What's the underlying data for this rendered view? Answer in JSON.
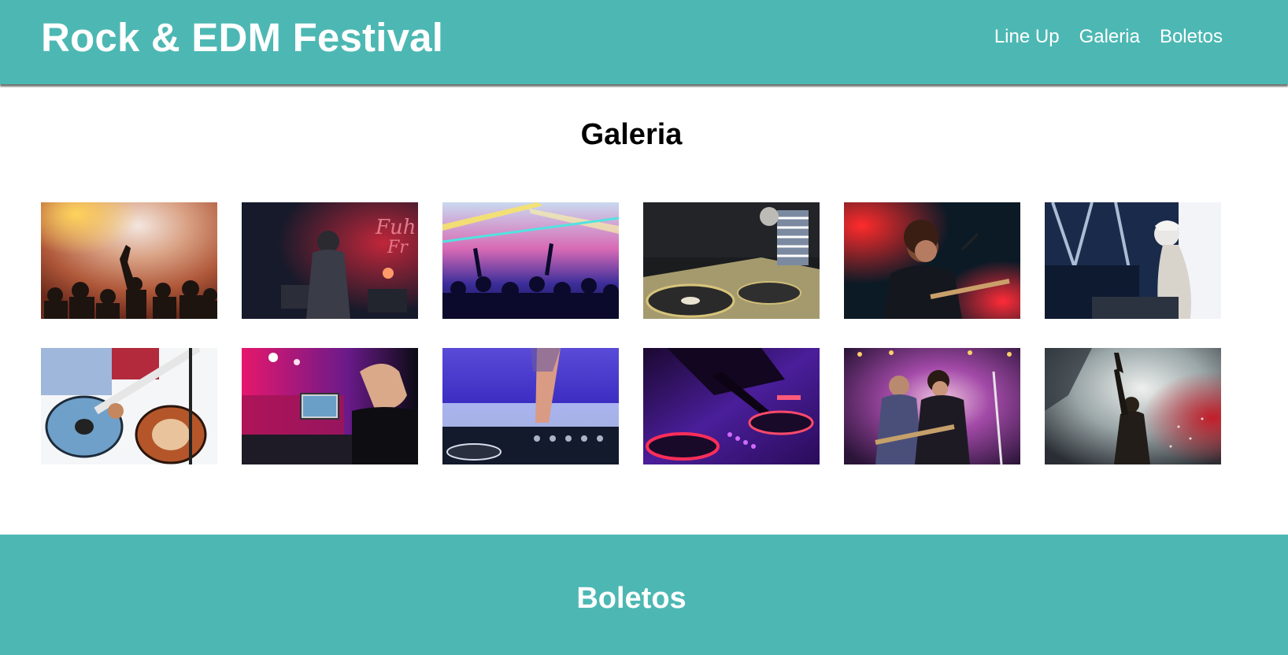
{
  "header": {
    "brand": "Rock & EDM Festival",
    "nav": [
      {
        "label": "Line Up"
      },
      {
        "label": "Galeria"
      },
      {
        "label": "Boletos"
      }
    ]
  },
  "gallery": {
    "title": "Galeria",
    "photos": [
      {
        "subject": "crowd-with-raised-hand-orange-lights"
      },
      {
        "subject": "rock-singer-red-stage"
      },
      {
        "subject": "crowd-under-laser-lights"
      },
      {
        "subject": "dj-turntables"
      },
      {
        "subject": "guitarist-singing-red-light"
      },
      {
        "subject": "female-dj-with-cap"
      },
      {
        "subject": "guitar-players-closeup"
      },
      {
        "subject": "dj-with-laptop-pink-club"
      },
      {
        "subject": "dj-hand-on-mixer-blue"
      },
      {
        "subject": "dj-controller-purple-glow"
      },
      {
        "subject": "two-rock-singers-on-stage"
      },
      {
        "subject": "singer-with-raised-arm-smoke"
      }
    ]
  },
  "tickets": {
    "title": "Boletos"
  },
  "colors": {
    "teal": "#4db8b3",
    "white": "#ffffff"
  }
}
